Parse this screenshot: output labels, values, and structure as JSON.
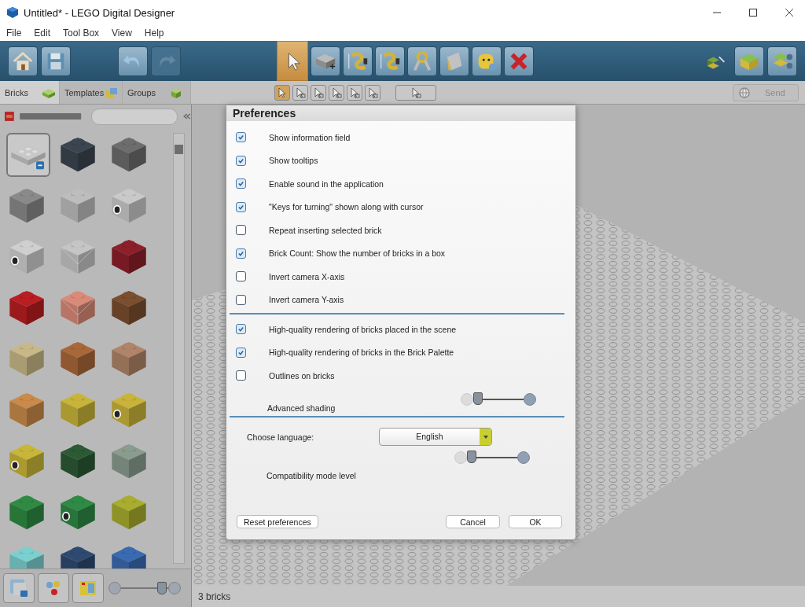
{
  "window": {
    "title": "Untitled* - LEGO Digital Designer"
  },
  "menu": [
    "File",
    "Edit",
    "Tool Box",
    "View",
    "Help"
  ],
  "toolbar": {
    "file_tools": [
      {
        "kind": "home",
        "disabled": false
      },
      {
        "kind": "save",
        "disabled": false
      },
      {
        "kind": "undo",
        "disabled": false
      },
      {
        "kind": "redo",
        "disabled": true
      }
    ],
    "tools": [
      {
        "kind": "select",
        "selected": true
      },
      {
        "kind": "add-brick",
        "selected": false
      },
      {
        "kind": "hinge",
        "selected": false
      },
      {
        "kind": "hinge-align",
        "selected": false
      },
      {
        "kind": "flex",
        "selected": false
      },
      {
        "kind": "paint",
        "selected": false
      },
      {
        "kind": "decorate",
        "selected": false
      },
      {
        "kind": "delete",
        "selected": false
      }
    ],
    "view_tools": [
      {
        "kind": "build-mode",
        "selected": false
      },
      {
        "kind": "view-mode",
        "selected": false
      },
      {
        "kind": "instructions",
        "selected": false
      }
    ]
  },
  "palette_tabs": [
    {
      "label": "Bricks",
      "selected": true
    },
    {
      "label": "Templates",
      "selected": false
    },
    {
      "label": "Groups",
      "selected": false
    }
  ],
  "select_modes": [
    {
      "kind": "single",
      "selected": true
    },
    {
      "kind": "multiple",
      "selected": false
    },
    {
      "kind": "connected",
      "selected": false
    },
    {
      "kind": "color",
      "selected": false
    },
    {
      "kind": "shape",
      "selected": false
    },
    {
      "kind": "color-shape",
      "selected": false
    },
    {
      "kind": "invert",
      "selected": false
    }
  ],
  "send_button": {
    "label": "Send",
    "disabled": true
  },
  "brick_palette": {
    "bricks": [
      {
        "kind": "plate-2x4",
        "color": "#c8c8c8",
        "selected": true
      },
      {
        "kind": "plain",
        "color": "#3b4550",
        "selected": false
      },
      {
        "kind": "plain",
        "color": "#6d6d6d",
        "selected": false
      },
      {
        "kind": "plain",
        "color": "#8a8a8a",
        "selected": false
      },
      {
        "kind": "plain",
        "color": "#bdbdbd",
        "selected": false
      },
      {
        "kind": "printed",
        "color": "#c9c9c9",
        "selected": false
      },
      {
        "kind": "printed",
        "color": "#cfcfcf",
        "selected": false
      },
      {
        "kind": "transparent",
        "color": "#c5c5c5",
        "selected": false
      },
      {
        "kind": "plain",
        "color": "#8c1f2a",
        "selected": false
      },
      {
        "kind": "plain",
        "color": "#b81e22",
        "selected": false
      },
      {
        "kind": "transparent",
        "color": "#d98a78",
        "selected": false
      },
      {
        "kind": "plain",
        "color": "#7a4e2e",
        "selected": false
      },
      {
        "kind": "plain",
        "color": "#c8b887",
        "selected": false
      },
      {
        "kind": "plain",
        "color": "#a8683a",
        "selected": false
      },
      {
        "kind": "plain",
        "color": "#b08468",
        "selected": false
      },
      {
        "kind": "plain",
        "color": "#c98a4a",
        "selected": false
      },
      {
        "kind": "plain",
        "color": "#c8b43a",
        "selected": false
      },
      {
        "kind": "printed",
        "color": "#c9b33a",
        "selected": false
      },
      {
        "kind": "printed",
        "color": "#c8b638",
        "selected": false
      },
      {
        "kind": "plain",
        "color": "#2c5a34",
        "selected": false
      },
      {
        "kind": "plain",
        "color": "#8a9c8e",
        "selected": false
      },
      {
        "kind": "plain",
        "color": "#2f8a42",
        "selected": false
      },
      {
        "kind": "printed",
        "color": "#2f8a46",
        "selected": false
      },
      {
        "kind": "plain",
        "color": "#a8ad2e",
        "selected": false
      },
      {
        "kind": "plain",
        "color": "#7ccfcf",
        "selected": false
      },
      {
        "kind": "plain",
        "color": "#2f4a70",
        "selected": false
      },
      {
        "kind": "plain",
        "color": "#3a6ab2",
        "selected": false
      }
    ],
    "bottom_tools": [
      {
        "kind": "brick-view",
        "selected": false
      },
      {
        "kind": "color-view",
        "selected": false
      },
      {
        "kind": "catalog-view",
        "selected": false
      }
    ],
    "zoom": {
      "level": 0.85
    }
  },
  "dialog": {
    "title": "Preferences",
    "groups": [
      [
        {
          "kind": "checkbox",
          "label": "Show information field",
          "checked": true
        },
        {
          "kind": "checkbox",
          "label": "Show tooltips",
          "checked": true
        },
        {
          "kind": "checkbox",
          "label": "Enable sound in the application",
          "checked": true
        },
        {
          "kind": "checkbox",
          "label": "\"Keys for turning\" shown along with cursor",
          "checked": true
        },
        {
          "kind": "checkbox",
          "label": "Repeat inserting selected brick",
          "checked": false
        },
        {
          "kind": "checkbox",
          "label": "Brick Count: Show the number of bricks in a box",
          "checked": true
        },
        {
          "kind": "checkbox",
          "label": "Invert camera X-axis",
          "checked": false
        },
        {
          "kind": "checkbox",
          "label": "Invert camera Y-axis",
          "checked": false
        }
      ],
      [
        {
          "kind": "checkbox",
          "label": "High-quality rendering of bricks placed in the scene",
          "checked": true
        },
        {
          "kind": "checkbox",
          "label": "High-quality rendering of bricks in the Brick Palette",
          "checked": true
        },
        {
          "kind": "checkbox",
          "label": "Outlines on bricks",
          "checked": false
        },
        {
          "kind": "slider",
          "label": "Advanced shading",
          "level": 0
        }
      ],
      [
        {
          "kind": "dropdown",
          "label": "Choose language:",
          "value": "English"
        },
        {
          "kind": "slider",
          "label": "Compatibility mode level",
          "level": 0
        }
      ]
    ],
    "buttons": [
      {
        "kind": "reset",
        "label": "Reset preferences"
      },
      {
        "kind": "cancel",
        "label": "Cancel"
      },
      {
        "kind": "ok",
        "label": "OK"
      }
    ]
  },
  "status_bar": "3 bricks"
}
